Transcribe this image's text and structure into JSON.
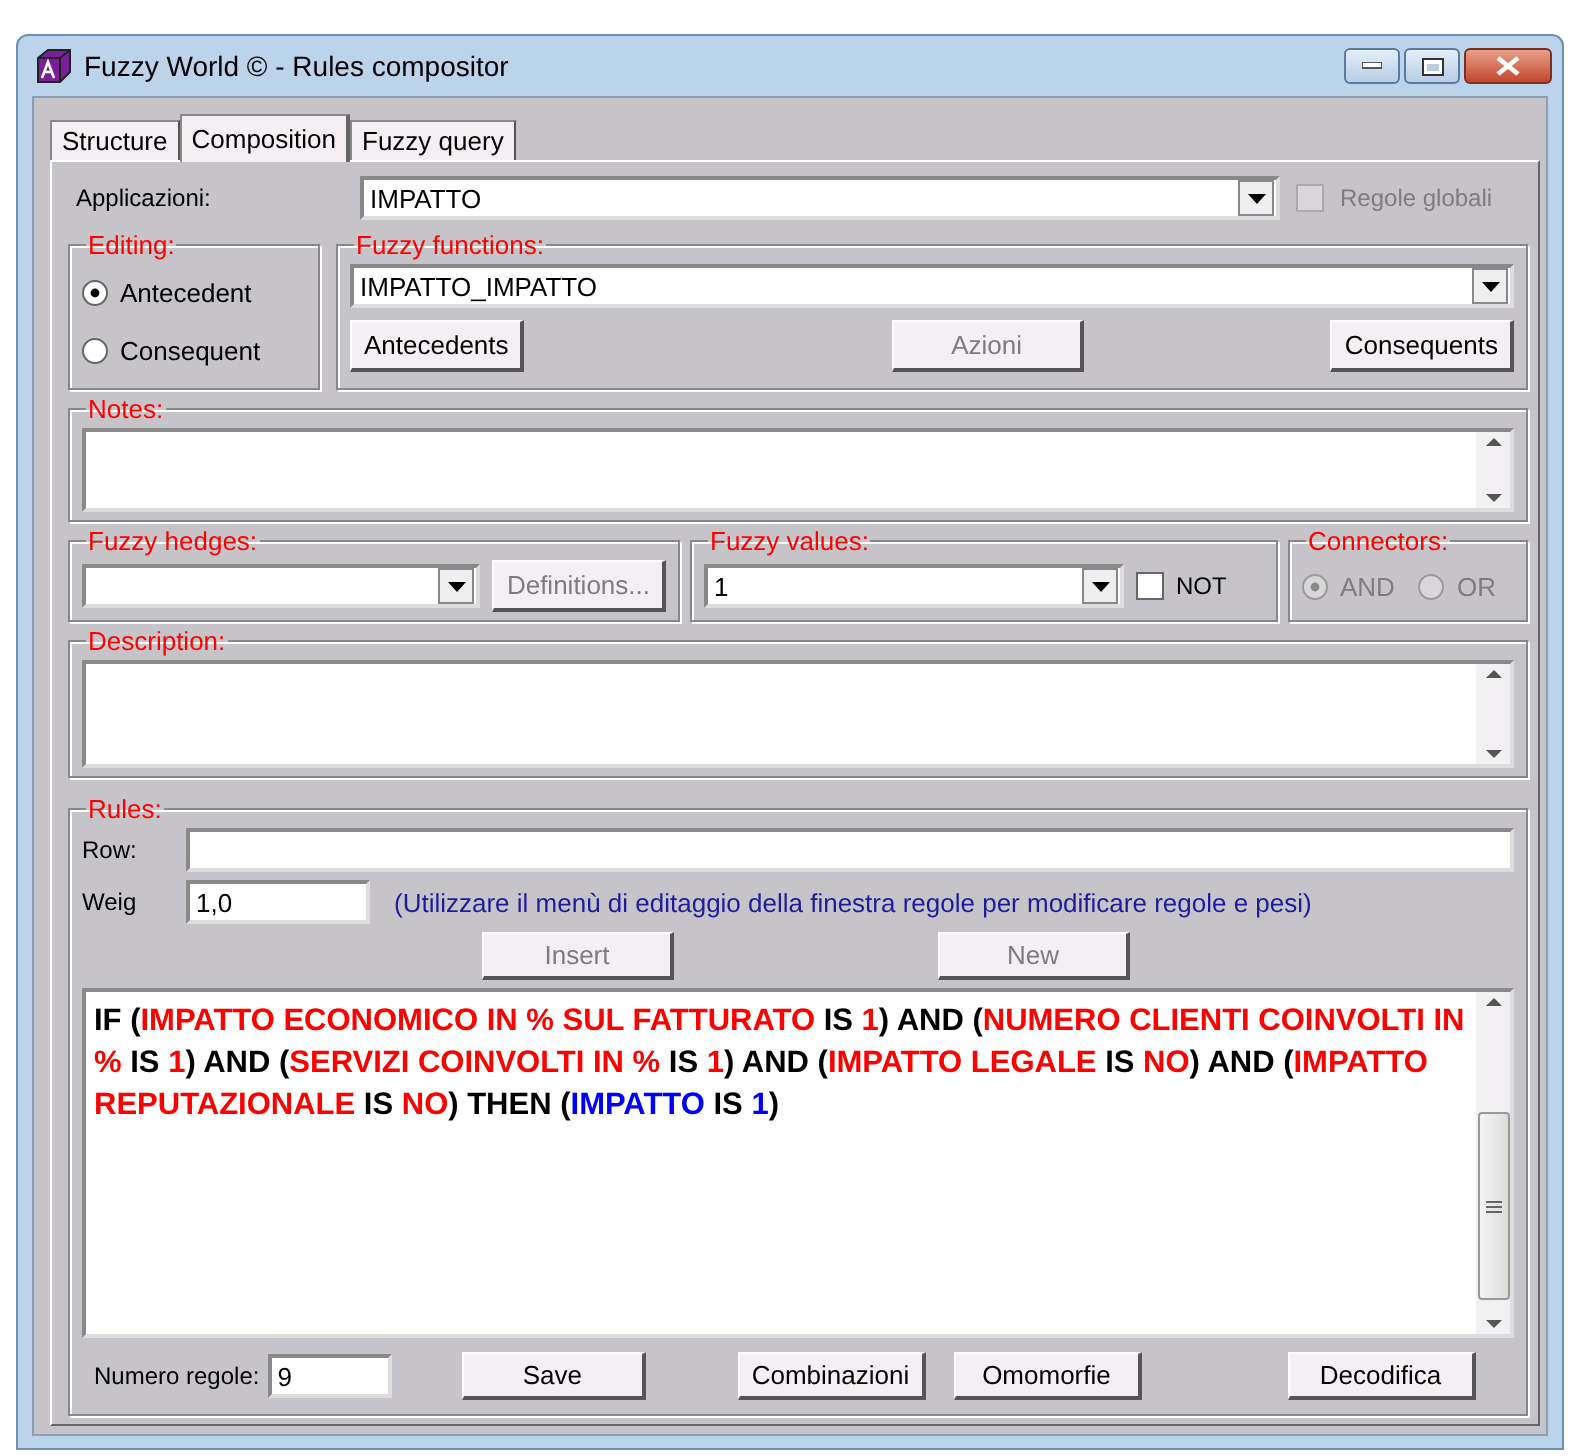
{
  "window": {
    "title": "Fuzzy World © - Rules compositor"
  },
  "tabs": [
    {
      "label": "Structure",
      "selected": false
    },
    {
      "label": "Composition",
      "selected": true
    },
    {
      "label": "Fuzzy query",
      "selected": false
    }
  ],
  "applicazioni": {
    "label": "Applicazioni:",
    "value": "IMPATTO",
    "global_rules": {
      "label": "Regole globali",
      "checked": false,
      "disabled": true
    }
  },
  "editing": {
    "title": "Editing:",
    "options": [
      {
        "label": "Antecedent",
        "selected": true
      },
      {
        "label": "Consequent",
        "selected": false
      }
    ]
  },
  "fuzzy_functions": {
    "title": "Fuzzy functions:",
    "value": "IMPATTO_IMPATTO",
    "buttons": [
      {
        "label": "Antecedents",
        "disabled": false
      },
      {
        "label": "Azioni",
        "disabled": true
      },
      {
        "label": "Consequents",
        "disabled": false
      }
    ]
  },
  "notes": {
    "title": "Notes:"
  },
  "fuzzy_hedges": {
    "title": "Fuzzy hedges:",
    "button": {
      "label": "Definitions...",
      "disabled": true
    }
  },
  "fuzzy_values": {
    "title": "Fuzzy values:",
    "value": "1",
    "not": {
      "label": "NOT",
      "checked": false
    }
  },
  "connectors": {
    "title": "Connectors:",
    "options": [
      {
        "label": "AND",
        "selected": true,
        "disabled": true
      },
      {
        "label": "OR",
        "selected": false,
        "disabled": true
      }
    ]
  },
  "description": {
    "title": "Description:"
  },
  "rules": {
    "title": "Rules:",
    "row_label": "Row:",
    "weight_label": "Weig",
    "weight_value": "1,0",
    "hint": "(Utilizzare il menù di editaggio della finestra regole per modificare regole e pesi)",
    "buttons": [
      {
        "label": "Insert",
        "disabled": true
      },
      {
        "label": "New",
        "disabled": true
      }
    ],
    "rule": [
      {
        "text": "IF (",
        "kind": "plain"
      },
      {
        "text": "IMPATTO ECONOMICO IN % SUL FATTURATO",
        "kind": "input"
      },
      {
        "text": " IS ",
        "kind": "plain"
      },
      {
        "text": "1",
        "kind": "input"
      },
      {
        "text": ") AND (",
        "kind": "plain"
      },
      {
        "text": "NUMERO CLIENTI COINVOLTI IN %",
        "kind": "input"
      },
      {
        "text": " IS ",
        "kind": "plain"
      },
      {
        "text": "1",
        "kind": "input"
      },
      {
        "text": ") AND (",
        "kind": "plain"
      },
      {
        "text": "SERVIZI COINVOLTI IN %",
        "kind": "input"
      },
      {
        "text": " IS ",
        "kind": "plain"
      },
      {
        "text": "1",
        "kind": "input"
      },
      {
        "text": ") AND (",
        "kind": "plain"
      },
      {
        "text": "IMPATTO LEGALE",
        "kind": "input"
      },
      {
        "text": " IS ",
        "kind": "plain"
      },
      {
        "text": "NO",
        "kind": "input"
      },
      {
        "text": ") AND (",
        "kind": "plain"
      },
      {
        "text": "IMPATTO REPUTAZIONALE",
        "kind": "input"
      },
      {
        "text": " IS ",
        "kind": "plain"
      },
      {
        "text": "NO",
        "kind": "input"
      },
      {
        "text": ") THEN (",
        "kind": "plain"
      },
      {
        "text": "IMPATTO",
        "kind": "output"
      },
      {
        "text": " IS ",
        "kind": "plain"
      },
      {
        "text": "1",
        "kind": "output"
      },
      {
        "text": ")",
        "kind": "plain"
      }
    ],
    "count_label": "Numero regole:",
    "count": "9",
    "footer_buttons": [
      {
        "label": "Save",
        "disabled": false
      },
      {
        "label": "Combinazioni",
        "disabled": false
      },
      {
        "label": "Omomorfie",
        "disabled": false
      },
      {
        "label": "Decodifica",
        "disabled": false
      }
    ]
  }
}
